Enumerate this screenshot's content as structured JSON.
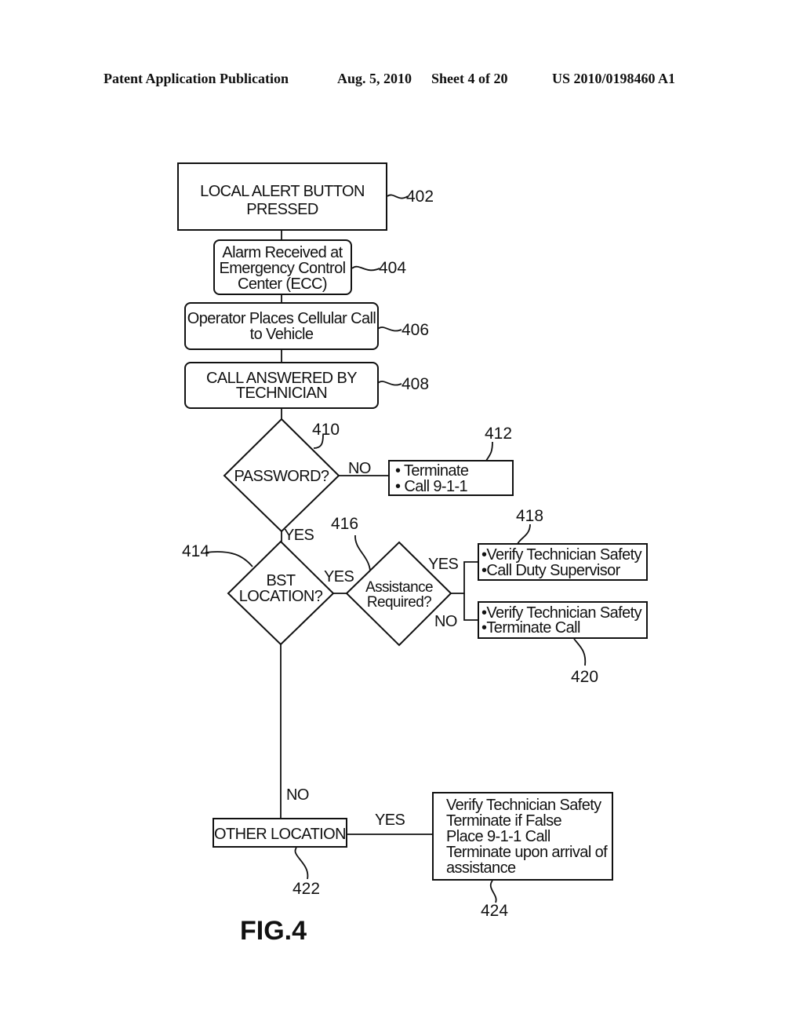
{
  "header": {
    "publication": "Patent Application Publication",
    "date": "Aug. 5, 2010",
    "sheet": "Sheet 4 of 20",
    "number": "US 2010/0198460 A1"
  },
  "figure_label": "FIG.4",
  "nodes": {
    "n402": {
      "ref": "402",
      "lines": [
        "LOCAL ALERT BUTTON",
        "PRESSED"
      ]
    },
    "n404": {
      "ref": "404",
      "lines": [
        "Alarm Received at",
        "Emergency Control",
        "Center (ECC)"
      ]
    },
    "n406": {
      "ref": "406",
      "lines": [
        "Operator Places Cellular Call",
        "to Vehicle"
      ]
    },
    "n408": {
      "ref": "408",
      "lines": [
        "CALL ANSWERED BY",
        "TECHNICIAN"
      ]
    },
    "n410": {
      "ref": "410",
      "lines": [
        "PASSWORD?"
      ]
    },
    "n412": {
      "ref": "412",
      "lines": [
        "• Terminate",
        "• Call 9-1-1"
      ]
    },
    "n414": {
      "ref": "414",
      "lines": [
        "BST",
        "LOCATION?"
      ]
    },
    "n416": {
      "ref": "416",
      "lines": [
        "Assistance",
        "Required?"
      ]
    },
    "n418": {
      "ref": "418",
      "lines": [
        "•Verify Technician Safety",
        "•Call Duty Supervisor"
      ]
    },
    "n420": {
      "ref": "420",
      "lines": [
        "•Verify Technician Safety",
        "•Terminate Call"
      ]
    },
    "n422": {
      "ref": "422",
      "lines": [
        "OTHER LOCATION"
      ]
    },
    "n424": {
      "ref": "424",
      "lines": [
        "Verify Technician Safety",
        "Terminate if False",
        "Place 9-1-1 Call",
        "Terminate upon arrival of",
        "assistance"
      ]
    }
  },
  "edge_labels": {
    "password_no": "NO",
    "password_yes": "YES",
    "bst_yes": "YES",
    "assist_yes": "YES",
    "assist_no": "NO",
    "bst_no": "NO",
    "other_yes": "YES"
  }
}
